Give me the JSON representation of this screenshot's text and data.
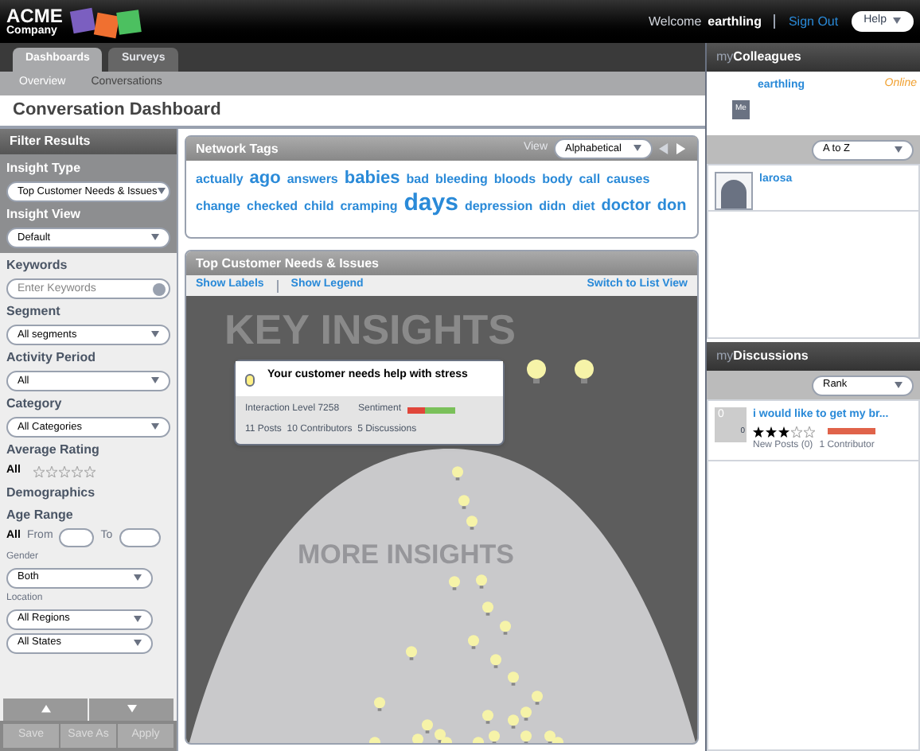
{
  "header": {
    "logo_top": "ACME",
    "logo_bottom": "Company",
    "welcome": "Welcome",
    "user": "earthling",
    "sign_out": "Sign Out",
    "help": "Help"
  },
  "tabs": [
    {
      "label": "Dashboards",
      "selected": true
    },
    {
      "label": "Surveys",
      "selected": false
    }
  ],
  "subtabs": [
    {
      "label": "Overview",
      "selected": true
    },
    {
      "label": "Conversations",
      "selected": false
    }
  ],
  "page_title": "Conversation Dashboard",
  "filters": {
    "title": "Filter Results",
    "insight_type": {
      "label": "Insight Type",
      "value": "Top Customer Needs & Issues"
    },
    "insight_view": {
      "label": "Insight View",
      "value": "Default"
    },
    "keywords": {
      "label": "Keywords",
      "placeholder": "Enter Keywords"
    },
    "segment": {
      "label": "Segment",
      "value": "All segments"
    },
    "activity_period": {
      "label": "Activity Period",
      "value": "All"
    },
    "category": {
      "label": "Category",
      "value": "All Categories"
    },
    "average_rating": {
      "label": "Average Rating",
      "value": "All",
      "stars": 0
    },
    "demographics": "Demographics",
    "age_range": {
      "label": "Age Range",
      "all": "All",
      "from": "From",
      "to": "To"
    },
    "gender": {
      "label": "Gender",
      "value": "Both"
    },
    "location": {
      "label": "Location",
      "region": "All Regions",
      "state": "All States"
    },
    "buttons": [
      "Save",
      "Save As",
      "Apply"
    ]
  },
  "network_tags": {
    "title": "Network Tags",
    "view_label": "View",
    "view_value": "Alphabetical",
    "tags": [
      {
        "text": "actually",
        "kind": "small"
      },
      {
        "text": "ago",
        "kind": "large"
      },
      {
        "text": "answers",
        "kind": "small"
      },
      {
        "text": "babies",
        "kind": "large"
      },
      {
        "text": "bad",
        "kind": "small"
      },
      {
        "text": "bleeding",
        "kind": "small"
      },
      {
        "text": "bloods",
        "kind": "small"
      },
      {
        "text": "body",
        "kind": "small"
      },
      {
        "text": "call",
        "kind": "small"
      },
      {
        "text": "causes",
        "kind": "small"
      },
      {
        "text": "change",
        "kind": "small"
      },
      {
        "text": "checked",
        "kind": "small"
      },
      {
        "text": "child",
        "kind": "small"
      },
      {
        "text": "cramping",
        "kind": "small"
      },
      {
        "text": "days",
        "kind": "xlarge"
      },
      {
        "text": "depression",
        "kind": "small"
      },
      {
        "text": "didn",
        "kind": "small"
      },
      {
        "text": "diet",
        "kind": "small"
      },
      {
        "text": "doctor",
        "kind": "medium"
      },
      {
        "text": "don",
        "kind": "medium"
      }
    ]
  },
  "insights": {
    "title": "Top Customer Needs & Issues",
    "show_labels": "Show Labels",
    "show_legend": "Show Legend",
    "switch_view": "Switch to List View",
    "top_label": "KEY INSIGHTS",
    "bottom_label": "MORE INSIGHTS",
    "tooltip": {
      "title": "Your customer needs help with stress",
      "interaction": "Interaction Level 7258",
      "sentiment_label": "Sentiment",
      "level": 0.35,
      "stats": "11 Posts  10 Contributors  5 Discussions"
    }
  },
  "colleagues": {
    "title_light": "my",
    "title_bold": "Colleagues",
    "me": {
      "name": "earthling",
      "status": "Online",
      "badge": "Me"
    },
    "sort": "A to Z",
    "people": [
      {
        "name": "larosa"
      }
    ]
  },
  "discussions": {
    "title_light": "my",
    "title_bold": "Discussions",
    "sort": "Rank",
    "items": [
      {
        "count": "0",
        "small_count": "0",
        "title": "i would like to get my br...",
        "stars": 3,
        "new_posts": "New Posts (0)",
        "contributors": "1 Contributor"
      }
    ]
  }
}
